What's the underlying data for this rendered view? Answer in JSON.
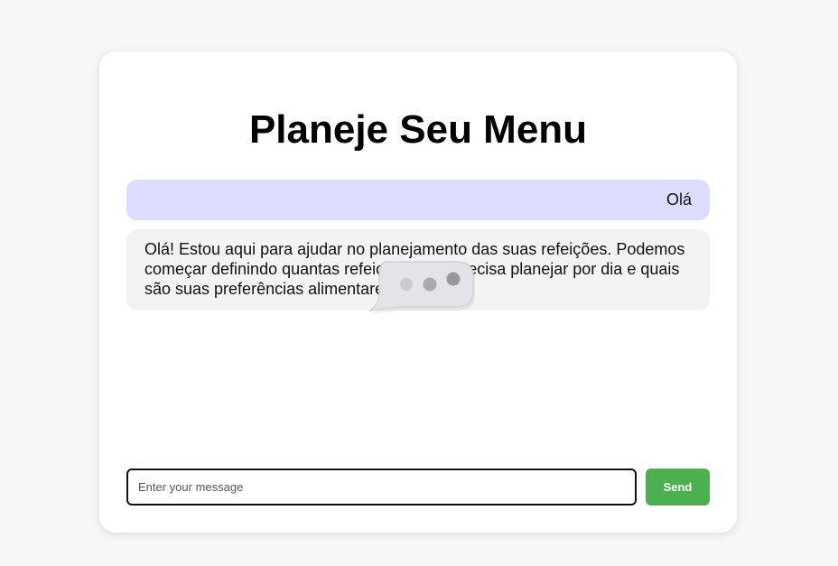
{
  "header": {
    "title": "Planeje Seu Menu"
  },
  "chat": {
    "messages": [
      {
        "role": "user",
        "text": "Olá"
      },
      {
        "role": "assistant",
        "text": "Olá! Estou aqui para ajudar no planejamento das suas refeições. Podemos começar definindo quantas refeições você precisa planejar por dia e quais são suas preferências alimentares?"
      }
    ],
    "typing_indicator_icon": "typing-bubble-icon"
  },
  "composer": {
    "placeholder": "Enter your message",
    "value": "",
    "send_label": "Send"
  },
  "colors": {
    "background": "#f7f7f7",
    "card": "#ffffff",
    "user_bubble": "#dcdcfe",
    "assistant_bubble": "#f3f3f3",
    "send_button": "#4caf50"
  }
}
